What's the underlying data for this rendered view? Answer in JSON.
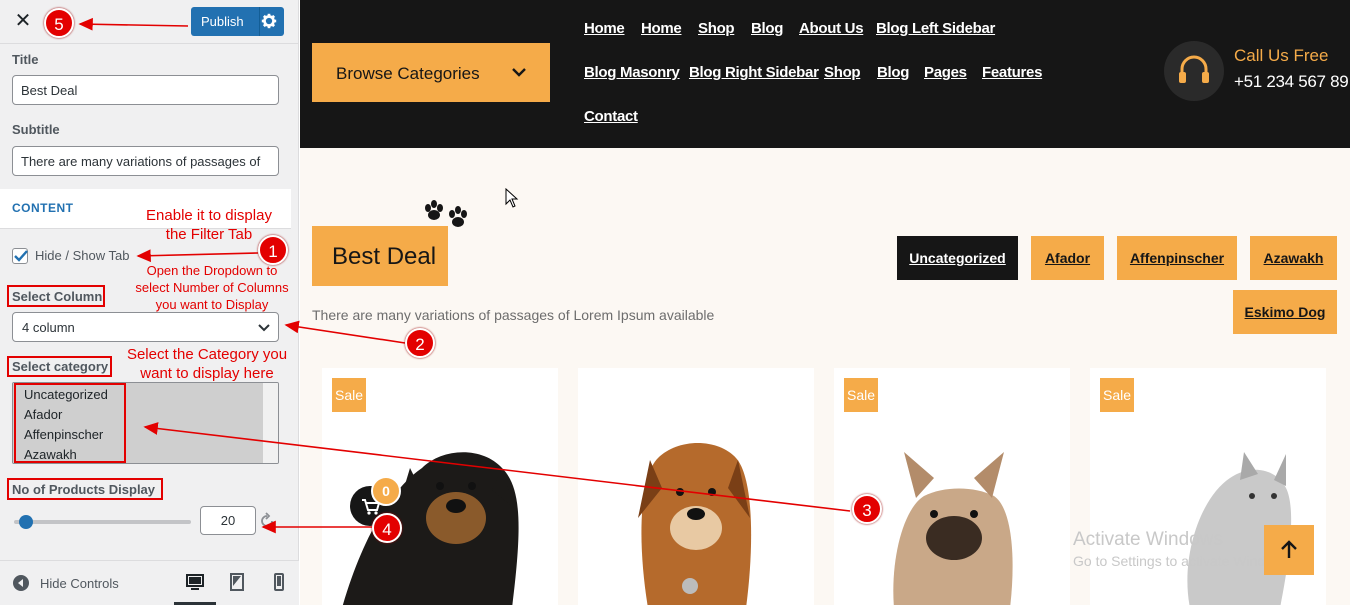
{
  "customizer": {
    "close_icon": "close-icon",
    "publish_label": "Publish",
    "title_label": "Title",
    "title_value": "Best Deal",
    "subtitle_label": "Subtitle",
    "subtitle_value": "There are many variations of passages of",
    "section_label": "CONTENT",
    "hide_show_tab_label": "Hide / Show Tab",
    "hide_show_tab_checked": true,
    "select_column_label": "Select Column",
    "select_column_value": "4 column",
    "select_category_label": "Select category",
    "categories": [
      "Uncategorized",
      "Afador",
      "Affenpinscher",
      "Azawakh"
    ],
    "products_display_label": "No of Products Display",
    "products_display_value": "20",
    "hide_controls_label": "Hide Controls",
    "accent": "#2271b1"
  },
  "annotations": {
    "enable_tab": "Enable it to display\nthe Filter Tab",
    "dropdown": "Open the Dropdown to\nselect Number of Columns\nyou want to Display",
    "category": "Select the Category you\nwant to display here",
    "badges": [
      "1",
      "2",
      "3",
      "4",
      "5"
    ],
    "color": "#e30000"
  },
  "site": {
    "browse_label": "Browse Categories",
    "nav": [
      "Home",
      "Home",
      "Shop",
      "Blog",
      "About Us",
      "Blog Left Sidebar",
      "Blog Masonry",
      "Blog Right Sidebar",
      "Shop",
      "Blog",
      "Pages",
      "Features",
      "Contact"
    ],
    "call_label": "Call Us Free",
    "call_phone": "+51 234 567 89",
    "section_title": "Best Deal",
    "section_subtitle": "There are many variations of passages of Lorem Ipsum available",
    "tabs": [
      "Uncategorized",
      "Afador",
      "Affenpinscher",
      "Azawakh",
      "Eskimo Dog"
    ],
    "sale_label": "Sale",
    "cart_count": "0",
    "watermark_title": "Activate Windows",
    "watermark_sub": "Go to Settings to activate Windows.",
    "accent": "#f5ab49",
    "dark": "#161616"
  }
}
